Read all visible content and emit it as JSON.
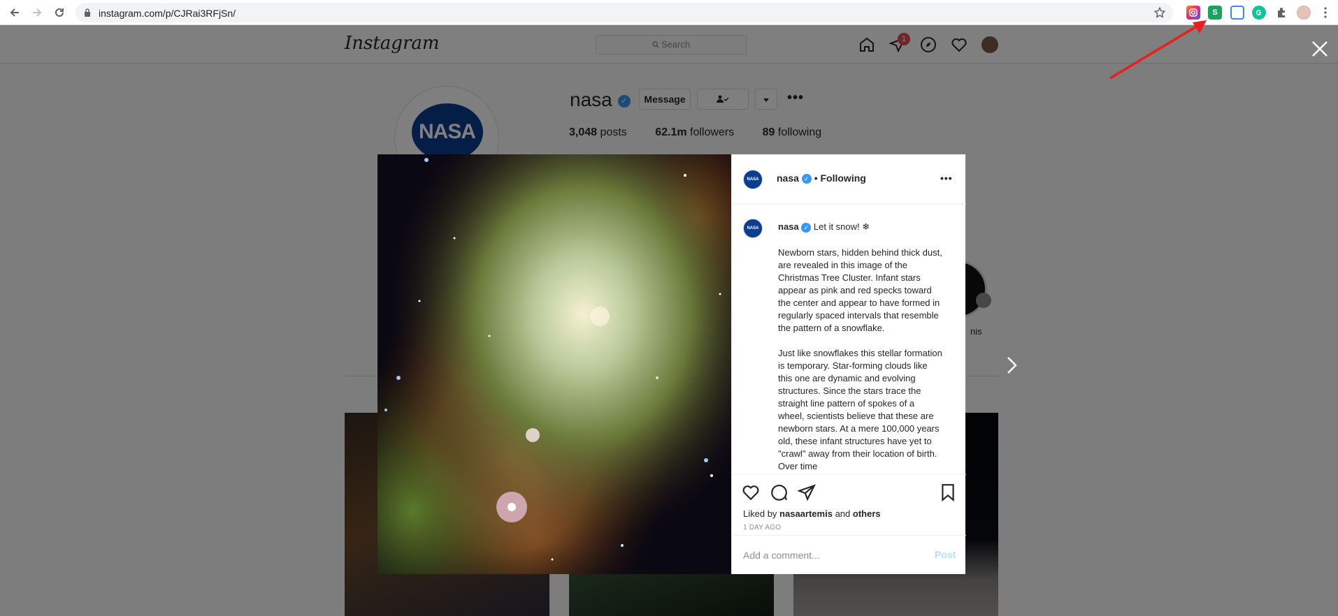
{
  "browser": {
    "url": "instagram.com/p/CJRai3RFjSn/",
    "extensions": [
      {
        "name": "instagram-extension",
        "color": "#c13584"
      },
      {
        "name": "s-extension",
        "color": "#1aa260",
        "label": "S"
      },
      {
        "name": "chrome-extension",
        "color": "#4285f4"
      },
      {
        "name": "grammarly-extension",
        "color": "#15c39a"
      }
    ]
  },
  "instagram": {
    "logo": "Instagram",
    "search_placeholder": "Search",
    "notification_count": "1"
  },
  "profile": {
    "username": "nasa",
    "avatar_text": "NASA",
    "message_label": "Message",
    "stats": {
      "posts_count": "3,048",
      "posts_label": "posts",
      "followers_count": "62.1m",
      "followers_label": "followers",
      "following_count": "89",
      "following_label": "following"
    },
    "highlight_label": "nis"
  },
  "post": {
    "username": "nasa",
    "follow_status": "• Following",
    "avatar_text": "NASA",
    "caption_title": "Let it snow! ❄",
    "caption_paragraph_1": "Newborn stars, hidden behind thick dust, are revealed in this image of the Christmas Tree Cluster. Infant stars appear as pink and red specks toward the center and appear to have formed in regularly spaced intervals that resemble the pattern of a snowflake.",
    "caption_paragraph_2": "Just like snowflakes this stellar formation is temporary. Star-forming clouds like this one are dynamic and evolving structures. Since the stars trace the straight line pattern of spokes of a wheel, scientists believe that these are newborn stars. At a mere 100,000 years old, these infant structures have yet to \"crawl\" away from their location of birth. Over time",
    "liked_by_prefix": "Liked by",
    "liked_by_user": "nasaartemis",
    "liked_by_and": "and",
    "liked_by_others": "others",
    "time_ago": "1 DAY AGO",
    "comment_placeholder": "Add a comment...",
    "post_button": "Post"
  },
  "colors": {
    "verified": "#3897f0",
    "badge": "#ed4956",
    "annotation_arrow": "#e8201d"
  }
}
